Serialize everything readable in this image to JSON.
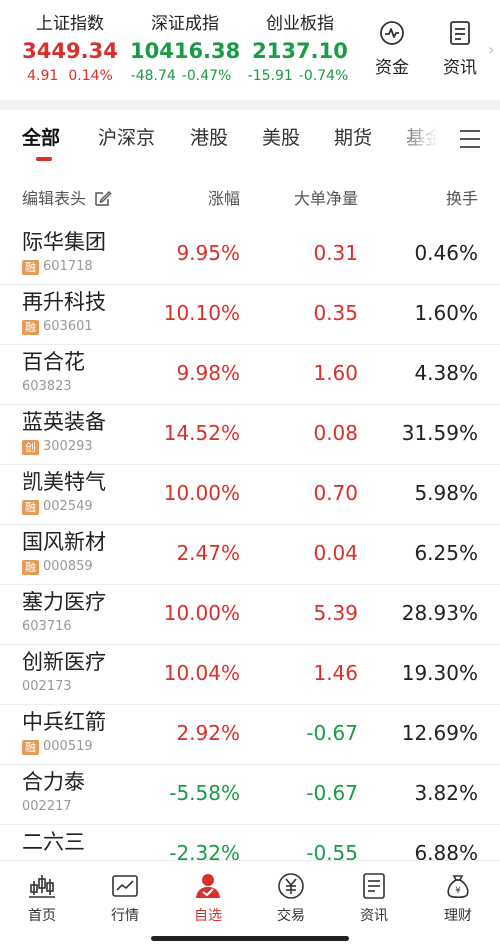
{
  "indices": [
    {
      "name": "上证指数",
      "value": "3449.34",
      "change": "4.91",
      "percent": "0.14%",
      "trend": "up"
    },
    {
      "name": "深证成指",
      "value": "10416.38",
      "change": "-48.74",
      "percent": "-0.47%",
      "trend": "down"
    },
    {
      "name": "创业板指",
      "value": "2137.10",
      "change": "-15.91",
      "percent": "-0.74%",
      "trend": "down"
    }
  ],
  "header_buttons": [
    {
      "label": "资金",
      "icon": "pulse-chart-icon"
    },
    {
      "label": "资讯",
      "icon": "document-icon"
    }
  ],
  "tabs": [
    {
      "label": "全部",
      "active": true
    },
    {
      "label": "沪深京",
      "active": false
    },
    {
      "label": "港股",
      "active": false
    },
    {
      "label": "美股",
      "active": false
    },
    {
      "label": "期货",
      "active": false
    },
    {
      "label": "基金",
      "active": false
    }
  ],
  "columns": {
    "edit": "编辑表头",
    "change": "涨幅",
    "net_inflow": "大单净量",
    "turnover": "换手"
  },
  "stocks": [
    {
      "name": "际华集团",
      "badge": "融",
      "code": "601718",
      "change": "9.95%",
      "net": "0.31",
      "turnover": "0.46%"
    },
    {
      "name": "再升科技",
      "badge": "融",
      "code": "603601",
      "change": "10.10%",
      "net": "0.35",
      "turnover": "1.60%"
    },
    {
      "name": "百合花",
      "badge": "",
      "code": "603823",
      "change": "9.98%",
      "net": "1.60",
      "turnover": "4.38%"
    },
    {
      "name": "蓝英装备",
      "badge": "创",
      "code": "300293",
      "change": "14.52%",
      "net": "0.08",
      "turnover": "31.59%"
    },
    {
      "name": "凯美特气",
      "badge": "融",
      "code": "002549",
      "change": "10.00%",
      "net": "0.70",
      "turnover": "5.98%"
    },
    {
      "name": "国风新材",
      "badge": "融",
      "code": "000859",
      "change": "2.47%",
      "net": "0.04",
      "turnover": "6.25%"
    },
    {
      "name": "塞力医疗",
      "badge": "",
      "code": "603716",
      "change": "10.00%",
      "net": "5.39",
      "turnover": "28.93%"
    },
    {
      "name": "创新医疗",
      "badge": "",
      "code": "002173",
      "change": "10.04%",
      "net": "1.46",
      "turnover": "19.30%"
    },
    {
      "name": "中兵红箭",
      "badge": "融",
      "code": "000519",
      "change": "2.92%",
      "net": "-0.67",
      "turnover": "12.69%"
    },
    {
      "name": "合力泰",
      "badge": "",
      "code": "002217",
      "change": "-5.58%",
      "net": "-0.67",
      "turnover": "3.82%"
    },
    {
      "name": "二六三",
      "badge": "",
      "code": "",
      "change": "-2.32%",
      "net": "-0.55",
      "turnover": "6.88%"
    }
  ],
  "bottom_nav": [
    {
      "label": "首页",
      "icon": "candlestick-icon",
      "active": false
    },
    {
      "label": "行情",
      "icon": "line-chart-icon",
      "active": false
    },
    {
      "label": "自选",
      "icon": "user-check-icon",
      "active": true
    },
    {
      "label": "交易",
      "icon": "yen-coin-icon",
      "active": false
    },
    {
      "label": "资讯",
      "icon": "news-icon",
      "active": false
    },
    {
      "label": "理财",
      "icon": "money-bag-icon",
      "active": false
    }
  ],
  "colors": {
    "up": "#d9302c",
    "down": "#1a9b45",
    "accent": "#d9302c",
    "badge": "#e59a55"
  }
}
